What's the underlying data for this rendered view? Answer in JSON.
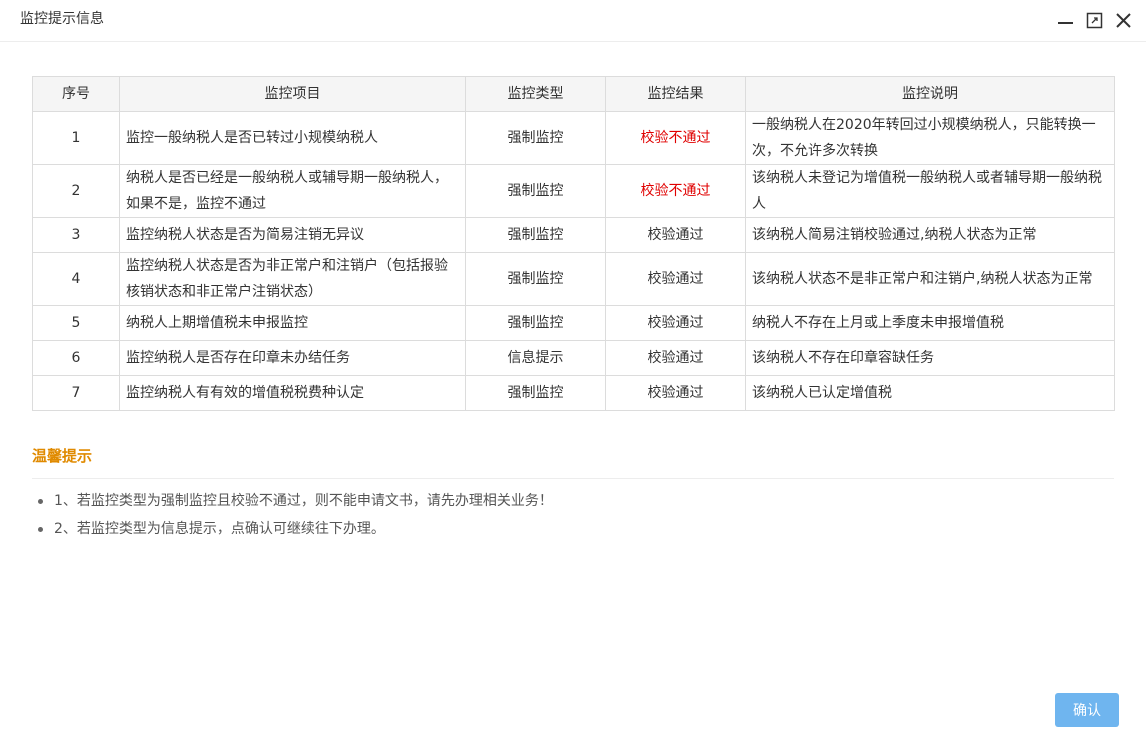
{
  "window": {
    "title": "监控提示信息"
  },
  "table": {
    "headers": [
      "序号",
      "监控项目",
      "监控类型",
      "监控结果",
      "监控说明"
    ],
    "rows": [
      {
        "no": "1",
        "item": "监控一般纳税人是否已转过小规模纳税人",
        "type": "强制监控",
        "result": "校验不通过",
        "desc": "一般纳税人在2020年转回过小规模纳税人，只能转换一次，不允许多次转换"
      },
      {
        "no": "2",
        "item": "纳税人是否已经是一般纳税人或辅导期一般纳税人，如果不是，监控不通过",
        "type": "强制监控",
        "result": "校验不通过",
        "desc": "该纳税人未登记为增值税一般纳税人或者辅导期一般纳税人"
      },
      {
        "no": "3",
        "item": "监控纳税人状态是否为简易注销无异议",
        "type": "强制监控",
        "result": "校验通过",
        "desc": "该纳税人简易注销校验通过,纳税人状态为正常"
      },
      {
        "no": "4",
        "item": "监控纳税人状态是否为非正常户和注销户（包括报验核销状态和非正常户注销状态）",
        "type": "强制监控",
        "result": "校验通过",
        "desc": "该纳税人状态不是非正常户和注销户,纳税人状态为正常"
      },
      {
        "no": "5",
        "item": "纳税人上期增值税未申报监控",
        "type": "强制监控",
        "result": "校验通过",
        "desc": "纳税人不存在上月或上季度未申报增值税"
      },
      {
        "no": "6",
        "item": "监控纳税人是否存在印章未办结任务",
        "type": "信息提示",
        "result": "校验通过",
        "desc": "该纳税人不存在印章容缺任务"
      },
      {
        "no": "7",
        "item": "监控纳税人有有效的增值税税费种认定",
        "type": "强制监控",
        "result": "校验通过",
        "desc": "该纳税人已认定增值税"
      }
    ]
  },
  "tips": {
    "title": "温馨提示",
    "items": [
      "1、若监控类型为强制监控且校验不通过，则不能申请文书，请先办理相关业务！",
      "2、若监控类型为信息提示，点确认可继续往下办理。"
    ]
  },
  "footer": {
    "confirm_label": "确认"
  },
  "colors": {
    "fail": "#e00000",
    "tips_title": "#e08a00",
    "confirm_bg": "#6fb5ef"
  }
}
